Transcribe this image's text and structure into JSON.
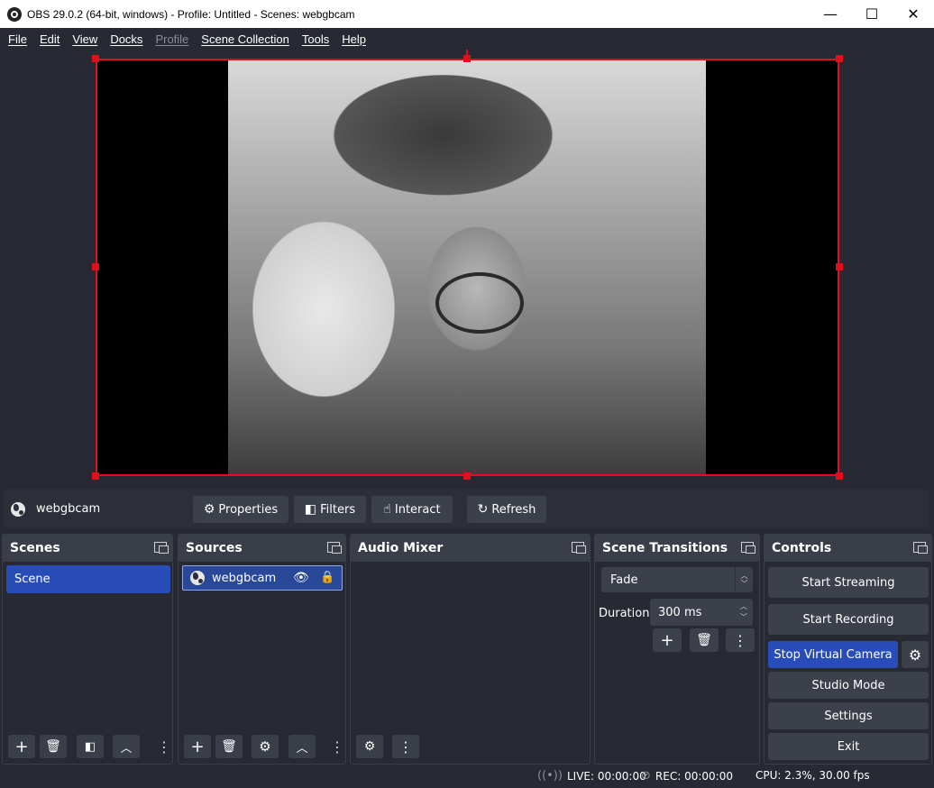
{
  "window": {
    "title": "OBS 29.0.2 (64-bit, windows) - Profile: Untitled - Scenes: webgbcam",
    "minimize": "—",
    "maximize": "☐",
    "close": "✕"
  },
  "menu": [
    "File",
    "Edit",
    "View",
    "Docks",
    "Profile",
    "Scene Collection",
    "Tools",
    "Help"
  ],
  "source_toolbar": {
    "source_name": "webgbcam",
    "properties": "Properties",
    "filters": "Filters",
    "interact": "Interact",
    "refresh": "Refresh"
  },
  "docks": {
    "scenes": {
      "title": "Scenes",
      "items": [
        "Scene"
      ]
    },
    "sources": {
      "title": "Sources",
      "items": [
        {
          "name": "webgbcam",
          "visible": true,
          "locked": true
        }
      ]
    },
    "audio_mixer": {
      "title": "Audio Mixer"
    },
    "transitions": {
      "title": "Scene Transitions",
      "selected": "Fade",
      "duration_label": "Duration",
      "duration_value": "300 ms"
    },
    "controls": {
      "title": "Controls",
      "start_streaming": "Start Streaming",
      "start_recording": "Start Recording",
      "stop_virtual_camera": "Stop Virtual Camera",
      "studio_mode": "Studio Mode",
      "settings": "Settings",
      "exit": "Exit"
    }
  },
  "status": {
    "live": "LIVE: 00:00:00",
    "rec": "REC: 00:00:00",
    "cpu": "CPU: 2.3%, 30.00 fps"
  },
  "colors": {
    "accent": "#284cb8",
    "selection": "#e0101a",
    "background": "#272a33"
  }
}
